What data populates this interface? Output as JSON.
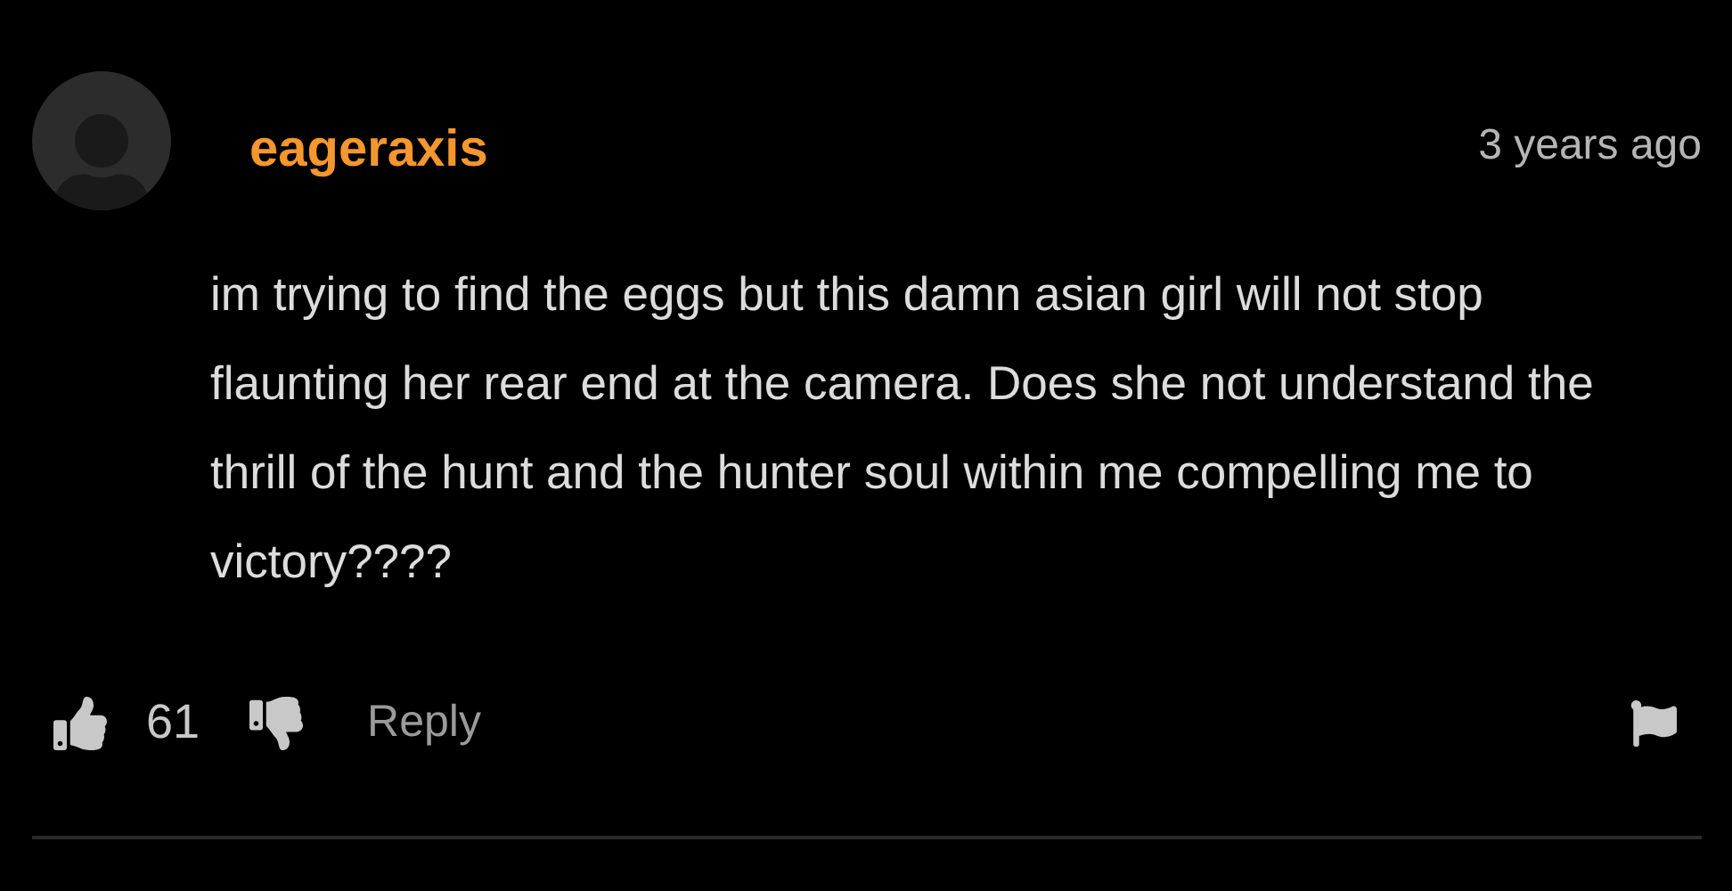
{
  "comment": {
    "username": "eageraxis",
    "time": "3 years ago",
    "body": "im trying to find the eggs but this damn asian girl will not stop flaunting her rear end at the camera. Does she not understand the thrill of the hunt and the hunter soul within me compelling me to victory????",
    "likes": "61",
    "reply": "Reply"
  }
}
